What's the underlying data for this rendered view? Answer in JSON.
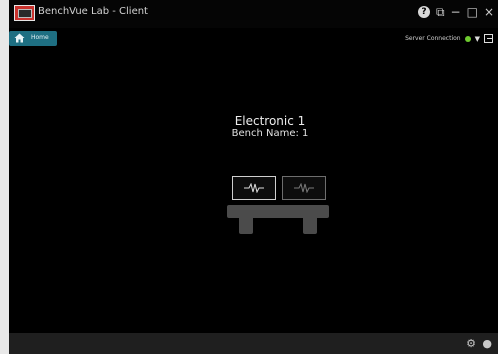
{
  "window": {
    "title": "BenchVue Lab - Client",
    "controls": {
      "help": "?",
      "restore_icon": "⧉",
      "minimize": "−",
      "maximize": "□",
      "close": "×"
    }
  },
  "nav": {
    "home_label": "Home",
    "server_label": "Server Connection",
    "server_status_color": "#6ecb2f"
  },
  "bench": {
    "title": "Electronic 1",
    "name": "Bench Name: 1",
    "instruments": [
      {
        "icon": "waveform-icon",
        "selected": true
      },
      {
        "icon": "waveform-icon",
        "selected": false
      }
    ]
  },
  "footer": {
    "gear": "⚙",
    "info": "●"
  },
  "colors": {
    "accent": "#1e6f82",
    "background": "#000000",
    "bench": "#4b4b4b"
  }
}
